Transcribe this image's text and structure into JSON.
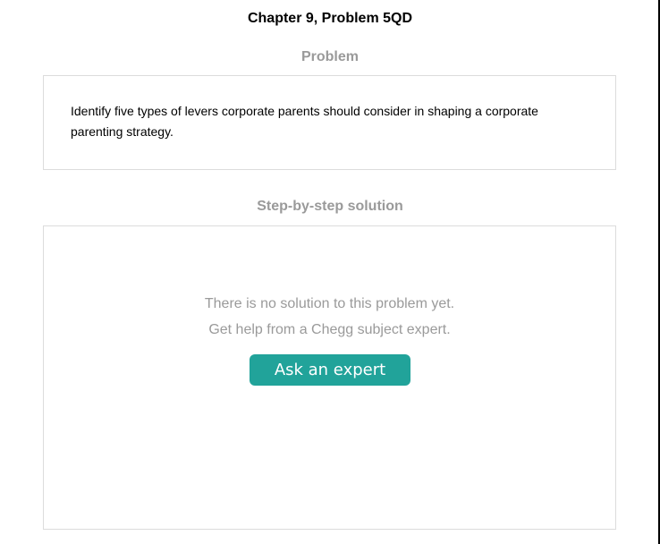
{
  "header": {
    "title": "Chapter 9, Problem 5QD"
  },
  "problem": {
    "heading": "Problem",
    "text": "Identify five types of levers corporate parents should consider in shaping a corporate parenting strategy."
  },
  "solution": {
    "heading": "Step-by-step solution",
    "message_line1": "There is no solution to this problem yet.",
    "message_line2": "Get help from a Chegg subject expert.",
    "button_label": "Ask an expert",
    "button_color": "#21a39a"
  }
}
